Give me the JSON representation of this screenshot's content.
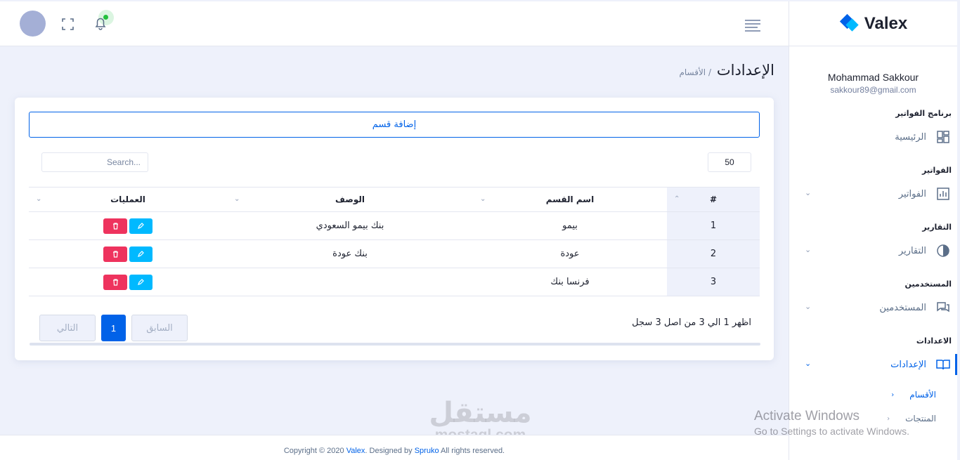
{
  "brand": {
    "name": "Valex",
    "primary": "#0162e8",
    "accent": "#00b9ff",
    "danger": "#ee335e"
  },
  "user": {
    "name": "Mohammad Sakkour",
    "email": "sakkour89@gmail.com"
  },
  "sidebar": {
    "sections": [
      {
        "title": "برنامج الفواتير",
        "item": "الرئيسية",
        "icon": "dashboard-icon"
      },
      {
        "title": "الفواتير",
        "item": "الفواتير",
        "icon": "bar-chart-icon"
      },
      {
        "title": "التقارير",
        "item": "التقارير",
        "icon": "pie-chart-icon"
      },
      {
        "title": "المستخدمين",
        "item": "المستخدمين",
        "icon": "chat-icon"
      },
      {
        "title": "الاعدادات",
        "item": "الإعدادات",
        "icon": "book-icon"
      }
    ],
    "sub_items": [
      "الأقسام",
      "المنتجات"
    ]
  },
  "breadcrumb": {
    "title": "الإعدادات",
    "current": "/ الأقسام"
  },
  "add_button": "إضافة قسم",
  "search_placeholder": "Search...",
  "per_page": "50",
  "table": {
    "headers": [
      "#",
      "اسم القسم",
      "الوصف",
      "العمليات"
    ],
    "rows": [
      {
        "num": "1",
        "name": "بيمو",
        "desc": "بنك بيمو السعودي"
      },
      {
        "num": "2",
        "name": "عودة",
        "desc": "بنك عودة"
      },
      {
        "num": "3",
        "name": "فرنسا بنك",
        "desc": ""
      }
    ]
  },
  "pagination": {
    "info": "اظهر 1 الي 3 من اصل 3 سجل",
    "prev": "السابق",
    "current": "1",
    "next": "التالي"
  },
  "footer": {
    "pre": "Copyright © 2020 ",
    "brand": "Valex",
    "mid": ". Designed by ",
    "by": "Spruko",
    "post": " All rights reserved."
  },
  "watermark": {
    "ar": "مستقل",
    "en": "mostaql.com"
  },
  "activate": {
    "title": "Activate Windows",
    "subtitle": "Go to Settings to activate Windows."
  }
}
